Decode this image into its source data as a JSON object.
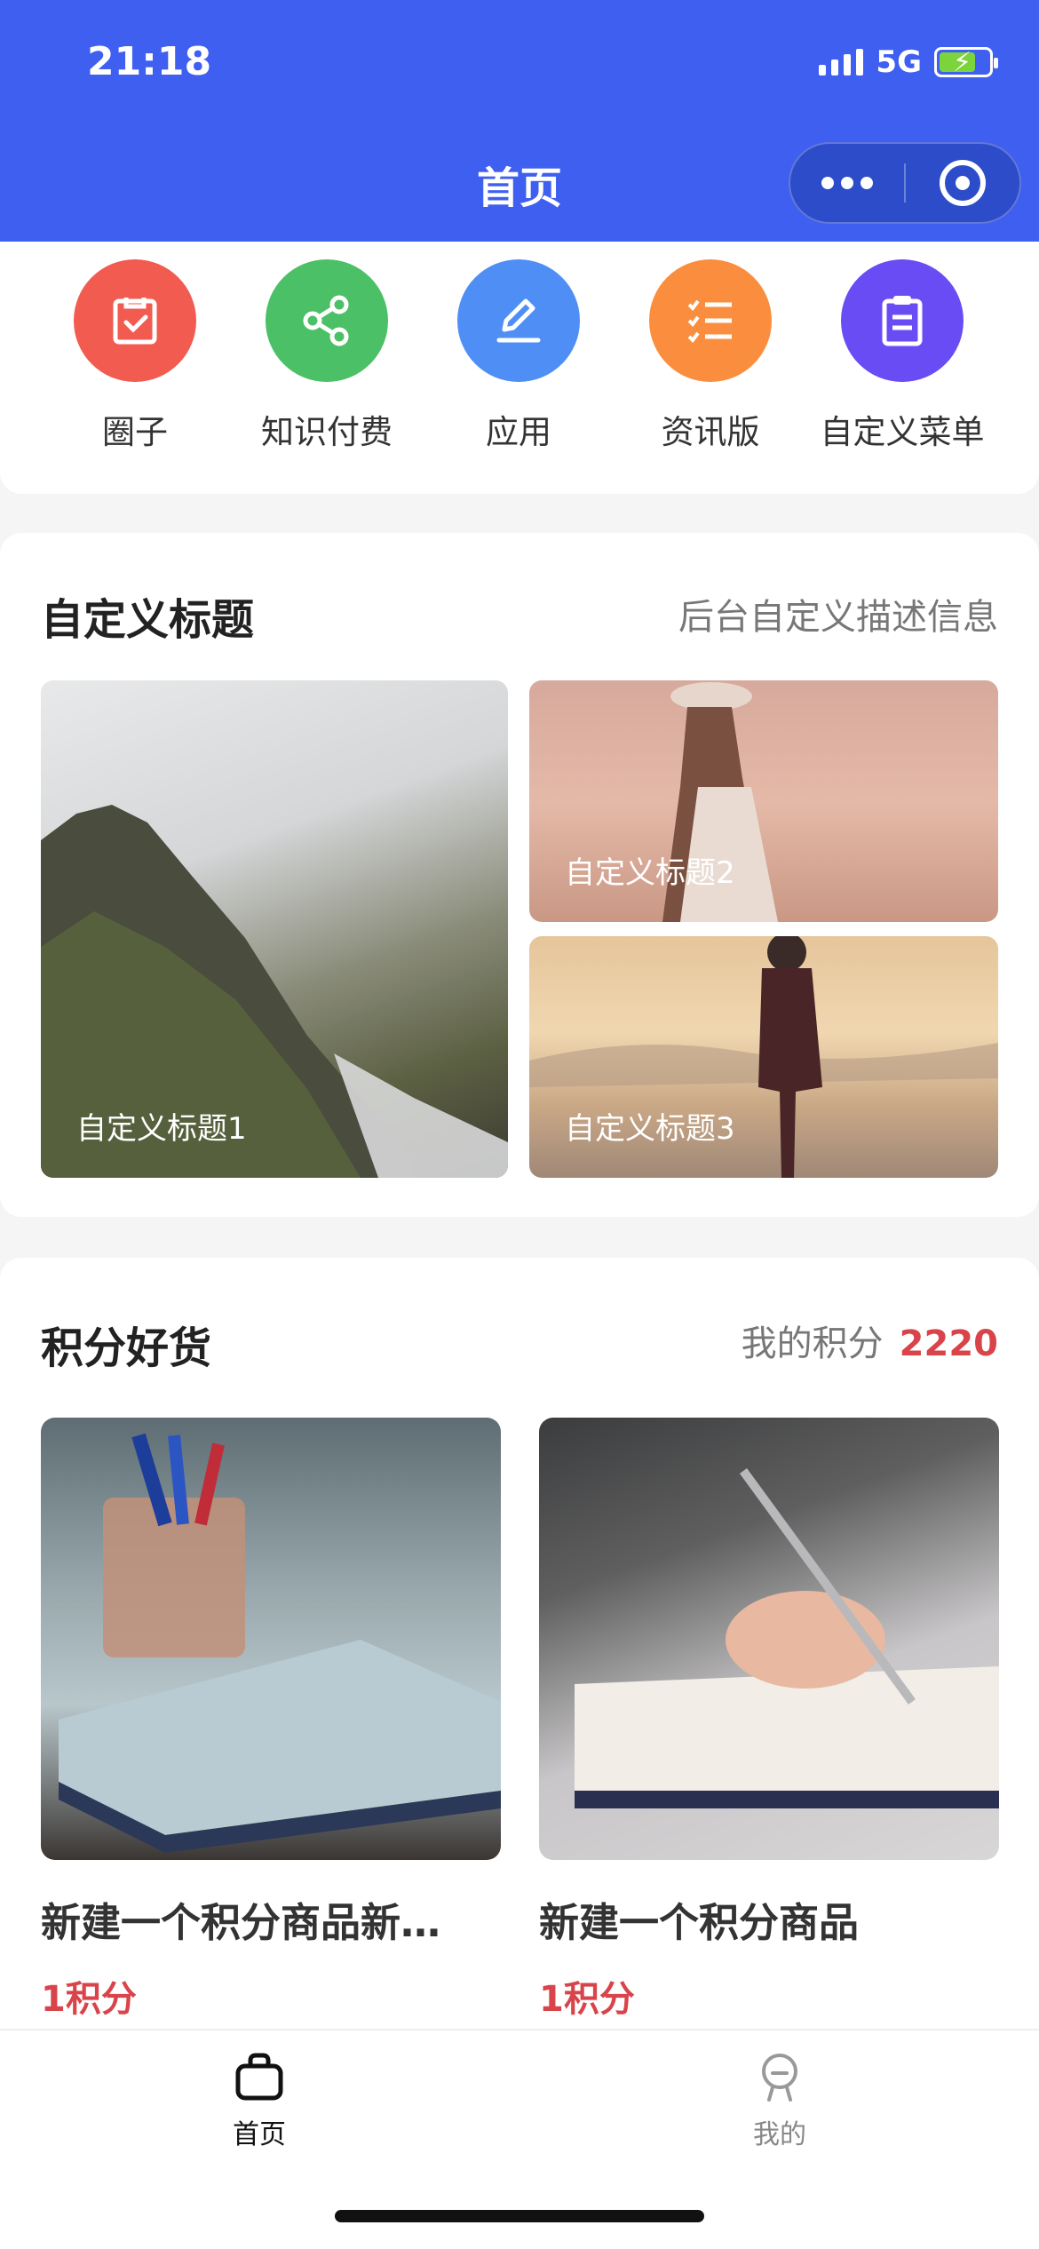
{
  "status": {
    "time": "21:18",
    "network": "5G"
  },
  "nav": {
    "title": "首页"
  },
  "menu": [
    {
      "label": "圈子",
      "icon": "clipboard-check-icon",
      "color": "#f25b50"
    },
    {
      "label": "知识付费",
      "icon": "share-icon",
      "color": "#4cc067"
    },
    {
      "label": "应用",
      "icon": "pencil-icon",
      "color": "#4f8ff5"
    },
    {
      "label": "资讯版",
      "icon": "checklist-icon",
      "color": "#fb8e3e"
    },
    {
      "label": "自定义菜单",
      "icon": "notepad-icon",
      "color": "#6a4cf5"
    }
  ],
  "gallery": {
    "title": "自定义标题",
    "description": "后台自定义描述信息",
    "items": [
      {
        "caption": "自定义标题1"
      },
      {
        "caption": "自定义标题2"
      },
      {
        "caption": "自定义标题3"
      }
    ]
  },
  "points": {
    "title": "积分好货",
    "my_points_label": "我的积分",
    "my_points_value": "2220",
    "products": [
      {
        "name": "新建一个积分商品新…",
        "points": "1积分"
      },
      {
        "name": "新建一个积分商品",
        "points": "1积分"
      }
    ]
  },
  "tabs": [
    {
      "label": "首页",
      "icon": "shopping-bag-icon",
      "active": true
    },
    {
      "label": "我的",
      "icon": "user-icon",
      "active": false
    }
  ],
  "colors": {
    "primary": "#3f5ff0",
    "accent_red": "#d9444b"
  }
}
